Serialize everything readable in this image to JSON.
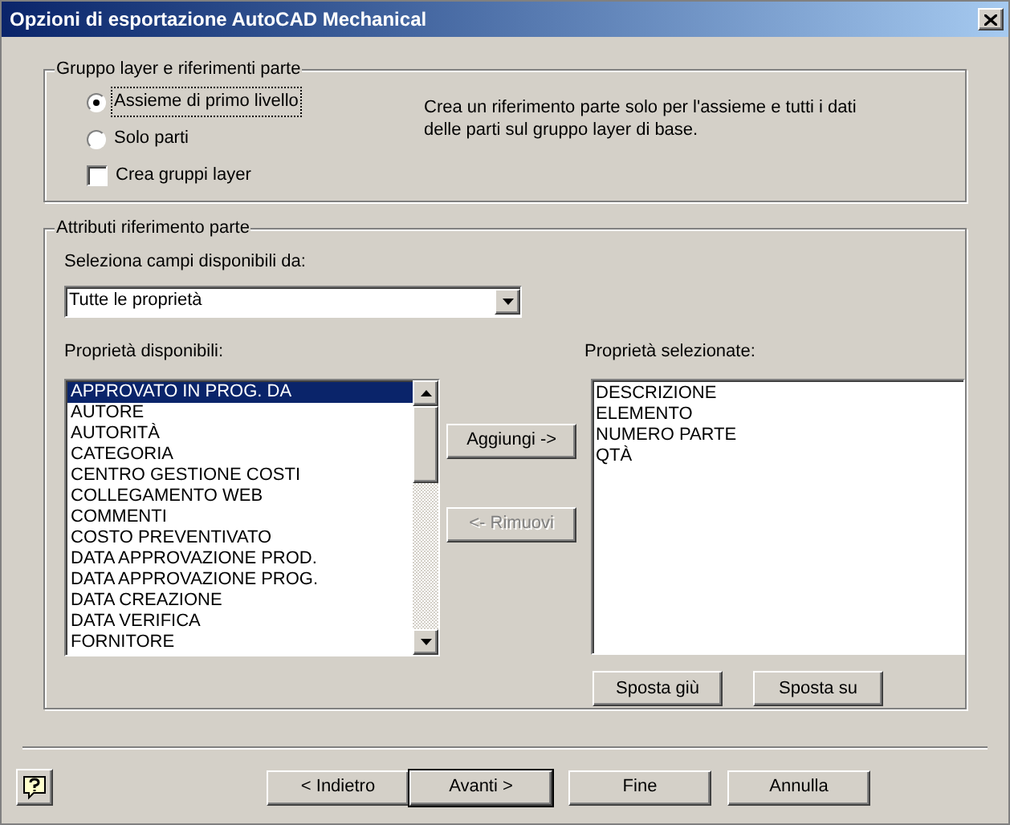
{
  "window": {
    "title": "Opzioni di esportazione AutoCAD Mechanical"
  },
  "layer_group": {
    "title": "Gruppo layer e riferimenti parte",
    "options": [
      {
        "kind": "radio",
        "label": "Assieme di primo livello",
        "selected": true
      },
      {
        "kind": "radio",
        "label": "Solo parti",
        "selected": false
      },
      {
        "kind": "checkbox",
        "label": "Crea gruppi layer",
        "checked": false
      }
    ],
    "description": "Crea un riferimento parte solo per l'assieme e tutti i dati delle parti sul gruppo layer di base."
  },
  "attributes": {
    "title": "Attributi riferimento parte",
    "source_label": "Seleziona campi disponibili da:",
    "source_value": "Tutte le proprietà",
    "available_label": "Proprietà disponibili:",
    "available": [
      {
        "label": "APPROVATO IN PROG. DA",
        "selected": true
      },
      {
        "label": "AUTORE",
        "selected": false
      },
      {
        "label": "AUTORITÀ",
        "selected": false
      },
      {
        "label": "CATEGORIA",
        "selected": false
      },
      {
        "label": "CENTRO GESTIONE COSTI",
        "selected": false
      },
      {
        "label": "COLLEGAMENTO WEB",
        "selected": false
      },
      {
        "label": "COMMENTI",
        "selected": false
      },
      {
        "label": "COSTO PREVENTIVATO",
        "selected": false
      },
      {
        "label": "DATA APPROVAZIONE PROD.",
        "selected": false
      },
      {
        "label": "DATA APPROVAZIONE PROG.",
        "selected": false
      },
      {
        "label": "DATA CREAZIONE",
        "selected": false
      },
      {
        "label": "DATA VERIFICA",
        "selected": false
      },
      {
        "label": "FORNITORE",
        "selected": false
      }
    ],
    "add_button": {
      "label": "Aggiungi ->",
      "disabled": false
    },
    "remove_button": {
      "label": "<- Rimuovi",
      "disabled": true
    },
    "selected_label": "Proprietà selezionate:",
    "selected_items": [
      "DESCRIZIONE",
      "ELEMENTO",
      "NUMERO PARTE",
      "QTÀ"
    ],
    "move_buttons": [
      "Sposta giù",
      "Sposta su"
    ]
  },
  "footer_buttons": [
    {
      "label": "< Indietro",
      "default": false
    },
    {
      "label": "Avanti >",
      "default": true
    },
    {
      "label": "Fine",
      "default": false
    },
    {
      "label": "Annulla",
      "default": false
    }
  ]
}
